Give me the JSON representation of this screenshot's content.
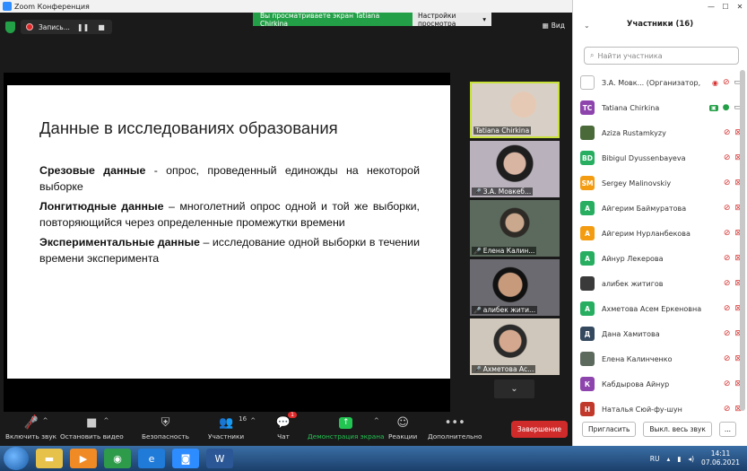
{
  "window": {
    "title": "Zoom Конференция"
  },
  "share_banner": {
    "text": "Вы просматриваете экран Tatiana Chirkina",
    "settings": "Настройки просмотра"
  },
  "recording": {
    "label": "Запись...",
    "pause": "❚❚",
    "stop": "■"
  },
  "view": {
    "label": "Вид"
  },
  "slide": {
    "title": "Данные в исследованиях образования",
    "items": [
      {
        "bold": "Срезовые данные",
        "text": " - опрос, проведенный единожды на некоторой выборке"
      },
      {
        "bold": "Лонгитюдные данные",
        "text": " – многолетний опрос одной и той же выборки, повторяющийся через определенные промежутки времени"
      },
      {
        "bold": "Экспериментальные данные",
        "text": " – исследование одной выборки в течении времени эксперимента"
      }
    ]
  },
  "thumbs": [
    {
      "label": "Tatiana Chirkina",
      "muted": false,
      "bg": "#d8d0c6"
    },
    {
      "label": "З.А. Мовкеб...",
      "muted": true,
      "bg": "#b9b1bc"
    },
    {
      "label": "Елена Калин...",
      "muted": true,
      "bg": "#5c6a5e"
    },
    {
      "label": "алибек жити...",
      "muted": true,
      "bg": "#6a6a70"
    },
    {
      "label": "Ахметова Ас...",
      "muted": true,
      "bg": "#cfc7bb"
    }
  ],
  "toolbar": {
    "unmute": "Включить звук",
    "stop_video": "Остановить видео",
    "security": "Безопасность",
    "participants": "Участники",
    "participants_count": "16",
    "chat": "Чат",
    "chat_badge": "1",
    "share": "Демонстрация экрана",
    "reactions": "Реакции",
    "more": "Дополнительно",
    "end": "Завершение"
  },
  "panel": {
    "title": "Участники (16)",
    "search_placeholder": "Найти участника",
    "participants": [
      {
        "initials": "",
        "name": "З.А. Мовк... (Организатор, я)",
        "color": "#ffffff",
        "state": "host"
      },
      {
        "initials": "TC",
        "name": "Tatiana Chirkina",
        "color": "#8e44ad",
        "state": "speaking"
      },
      {
        "initials": "",
        "name": "Aziza Rustamkyzy",
        "color": "#4a6a3a",
        "state": "off"
      },
      {
        "initials": "BD",
        "name": "Bibigul Dyussenbayeva",
        "color": "#27ae60",
        "state": "off"
      },
      {
        "initials": "SM",
        "name": "Sergey Malinovskiy",
        "color": "#f39c12",
        "state": "off"
      },
      {
        "initials": "А",
        "name": "Айгерим Баймуратова",
        "color": "#27ae60",
        "state": "off"
      },
      {
        "initials": "А",
        "name": "Айгерим Нурланбекова",
        "color": "#f39c12",
        "state": "off"
      },
      {
        "initials": "А",
        "name": "Айнур Лекерова",
        "color": "#27ae60",
        "state": "off"
      },
      {
        "initials": "",
        "name": "алибек житигов",
        "color": "#3a3a3a",
        "state": "off"
      },
      {
        "initials": "А",
        "name": "Ахметова Асем Еркеновна",
        "color": "#27ae60",
        "state": "off"
      },
      {
        "initials": "Д",
        "name": "Дана Хамитова",
        "color": "#34495e",
        "state": "off"
      },
      {
        "initials": "",
        "name": "Елена Калинченко",
        "color": "#5c6a5e",
        "state": "off"
      },
      {
        "initials": "К",
        "name": "Кабдырова Айнур",
        "color": "#8e44ad",
        "state": "off"
      },
      {
        "initials": "Н",
        "name": "Наталья Сюй-фу-шун",
        "color": "#c0392b",
        "state": "off"
      }
    ],
    "invite": "Пригласить",
    "mute_all": "Выкл. весь звук",
    "more": "..."
  },
  "taskbar": {
    "lang": "RU",
    "time": "14:11",
    "date": "07.06.2021"
  }
}
